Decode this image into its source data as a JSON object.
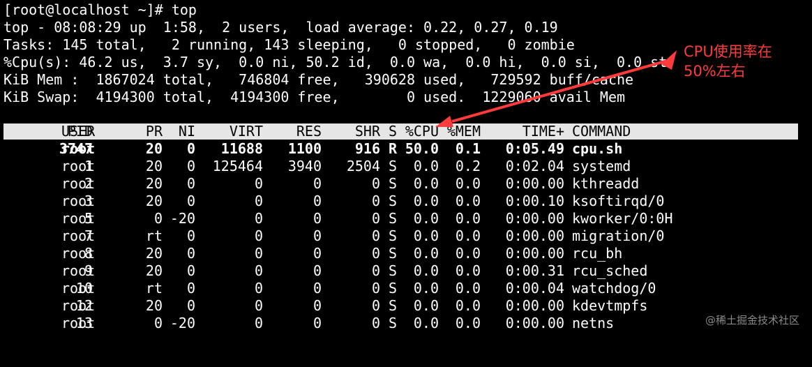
{
  "terminal": {
    "prompt": "[root@localhost ~]# top",
    "summary": [
      "top - 08:08:29 up  1:58,  2 users,  load average: 0.22, 0.27, 0.19",
      "Tasks: 145 total,   2 running, 143 sleeping,   0 stopped,   0 zombie",
      "%Cpu(s): 46.2 us,  3.7 sy,  0.0 ni, 50.2 id,  0.0 wa,  0.0 hi,  0.0 si,  0.0 st",
      "KiB Mem :  1867024 total,   746804 free,   390628 used,   729592 buff/cache",
      "KiB Swap:  4194300 total,  4194300 free,        0 used.  1229060 avail Mem"
    ]
  },
  "columns": {
    "pid": "PID",
    "user": "USER",
    "pr": "PR",
    "ni": "NI",
    "virt": "VIRT",
    "res": "RES",
    "shr": "SHR",
    "s": "S",
    "cpu": "%CPU",
    "mem": "%MEM",
    "time": "TIME+",
    "command": "COMMAND"
  },
  "processes": [
    {
      "pid": "3747",
      "user": "root",
      "pr": "20",
      "ni": "0",
      "virt": "11688",
      "res": "1100",
      "shr": "916",
      "s": "R",
      "cpu": "50.0",
      "mem": "0.1",
      "time": "0:05.49",
      "command": "cpu.sh"
    },
    {
      "pid": "1",
      "user": "root",
      "pr": "20",
      "ni": "0",
      "virt": "125464",
      "res": "3940",
      "shr": "2504",
      "s": "S",
      "cpu": "0.0",
      "mem": "0.2",
      "time": "0:02.04",
      "command": "systemd"
    },
    {
      "pid": "2",
      "user": "root",
      "pr": "20",
      "ni": "0",
      "virt": "0",
      "res": "0",
      "shr": "0",
      "s": "S",
      "cpu": "0.0",
      "mem": "0.0",
      "time": "0:00.00",
      "command": "kthreadd"
    },
    {
      "pid": "3",
      "user": "root",
      "pr": "20",
      "ni": "0",
      "virt": "0",
      "res": "0",
      "shr": "0",
      "s": "S",
      "cpu": "0.0",
      "mem": "0.0",
      "time": "0:00.10",
      "command": "ksoftirqd/0"
    },
    {
      "pid": "5",
      "user": "root",
      "pr": "0",
      "ni": "-20",
      "virt": "0",
      "res": "0",
      "shr": "0",
      "s": "S",
      "cpu": "0.0",
      "mem": "0.0",
      "time": "0:00.00",
      "command": "kworker/0:0H"
    },
    {
      "pid": "7",
      "user": "root",
      "pr": "rt",
      "ni": "0",
      "virt": "0",
      "res": "0",
      "shr": "0",
      "s": "S",
      "cpu": "0.0",
      "mem": "0.0",
      "time": "0:00.00",
      "command": "migration/0"
    },
    {
      "pid": "8",
      "user": "root",
      "pr": "20",
      "ni": "0",
      "virt": "0",
      "res": "0",
      "shr": "0",
      "s": "S",
      "cpu": "0.0",
      "mem": "0.0",
      "time": "0:00.00",
      "command": "rcu_bh"
    },
    {
      "pid": "9",
      "user": "root",
      "pr": "20",
      "ni": "0",
      "virt": "0",
      "res": "0",
      "shr": "0",
      "s": "S",
      "cpu": "0.0",
      "mem": "0.0",
      "time": "0:00.31",
      "command": "rcu_sched"
    },
    {
      "pid": "10",
      "user": "root",
      "pr": "rt",
      "ni": "0",
      "virt": "0",
      "res": "0",
      "shr": "0",
      "s": "S",
      "cpu": "0.0",
      "mem": "0.0",
      "time": "0:00.04",
      "command": "watchdog/0"
    },
    {
      "pid": "12",
      "user": "root",
      "pr": "20",
      "ni": "0",
      "virt": "0",
      "res": "0",
      "shr": "0",
      "s": "S",
      "cpu": "0.0",
      "mem": "0.0",
      "time": "0:00.00",
      "command": "kdevtmpfs"
    },
    {
      "pid": "13",
      "user": "root",
      "pr": "0",
      "ni": "-20",
      "virt": "0",
      "res": "0",
      "shr": "0",
      "s": "S",
      "cpu": "0.0",
      "mem": "0.0",
      "time": "0:00.00",
      "command": "netns"
    }
  ],
  "annotation": {
    "line1": "CPU使用率在",
    "line2": "50%左右",
    "color": "#ff3b3b"
  },
  "watermark": "@稀土掘金技术社区"
}
